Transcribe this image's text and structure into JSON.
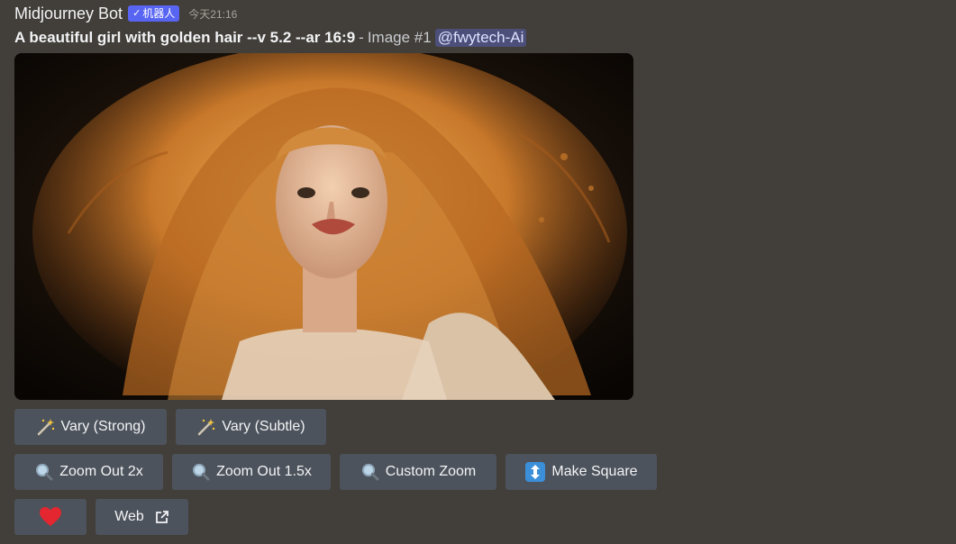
{
  "message": {
    "author": "Midjourney Bot",
    "bot_tag": "机器人",
    "timestamp": "今天21:16",
    "prompt": "A beautiful girl with golden hair --v 5.2 --ar 16:9",
    "separator": "-",
    "image_label": "Image #1",
    "mention": "@fwytech-Ai"
  },
  "buttons": {
    "vary_strong": "Vary (Strong)",
    "vary_subtle": "Vary (Subtle)",
    "zoom_out_2x": "Zoom Out 2x",
    "zoom_out_1_5x": "Zoom Out 1.5x",
    "custom_zoom": "Custom Zoom",
    "make_square": "Make Square",
    "web": "Web"
  },
  "icons": {
    "vary": "magic-wand-icon",
    "zoom": "magnifier-icon",
    "square": "up-down-arrow-icon",
    "favorite": "heart-icon",
    "external": "external-link-icon"
  },
  "colors": {
    "background": "#423e39",
    "button": "#4d535c",
    "bot_tag": "#5865f2",
    "mention_bg": "#4b4f7a",
    "heart": "#e3262f"
  }
}
